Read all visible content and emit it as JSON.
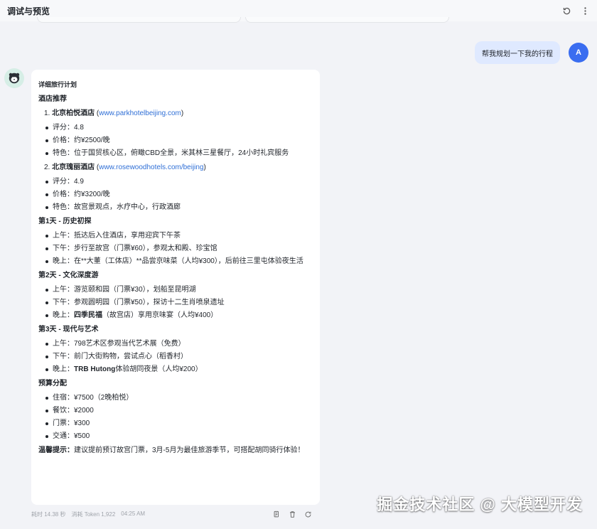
{
  "header": {
    "title": "调试与预览"
  },
  "user_message": {
    "text": "帮我规划一下我的行程",
    "avatar_letter": "A"
  },
  "reply": {
    "heading": "详细旅行计划",
    "hotels_title": "酒店推荐",
    "hotels": [
      {
        "index": "1.",
        "name": "北京柏悦酒店",
        "link": "www.parkhotelbeijing.com",
        "details": [
          "评分：4.8",
          "价格：约¥2500/晚",
          "特色：位于国贸核心区，俯瞰CBD全景，米其林三星餐厅，24小时礼宾服务"
        ]
      },
      {
        "index": "2.",
        "name": "北京瑰丽酒店",
        "link": "www.rosewoodhotels.com/beijing",
        "details": [
          "评分：4.9",
          "价格：约¥3200/晚",
          "特色：故宫景观点，水疗中心，行政酒廊"
        ]
      }
    ],
    "days": [
      {
        "title": "第1天 - 历史初探",
        "items": [
          {
            "prefix": "上午：",
            "bold": "",
            "rest": "抵达后入住酒店，享用迎宾下午茶"
          },
          {
            "prefix": "下午：",
            "bold": "",
            "rest": "步行至故宫（门票¥60），参观太和殿、珍宝馆"
          },
          {
            "prefix": "晚上：",
            "bold": "",
            "rest": "在**大董（工体店）**品尝京味菜（人均¥300），后前往三里屯体验夜生活"
          }
        ]
      },
      {
        "title": "第2天 - 文化深度游",
        "items": [
          {
            "prefix": "上午：",
            "bold": "",
            "rest": "游览颐和园（门票¥30），划船至昆明湖"
          },
          {
            "prefix": "下午：",
            "bold": "",
            "rest": "参观圆明园（门票¥50），探访十二生肖喷泉遗址"
          },
          {
            "prefix": "晚上：",
            "bold": "四季民福",
            "rest": "（故宫店）享用京味宴（人均¥400）"
          }
        ]
      },
      {
        "title": "第3天 - 现代与艺术",
        "items": [
          {
            "prefix": "上午：",
            "bold": "",
            "rest": "798艺术区参观当代艺术展（免费）"
          },
          {
            "prefix": "下午：",
            "bold": "",
            "rest": "前门大街购物，尝试点心（稻香村）"
          },
          {
            "prefix": "晚上：",
            "bold": "TRB Hutong",
            "rest": "体验胡同夜景（人均¥200）"
          }
        ]
      }
    ],
    "budget_title": "预算分配",
    "budget": [
      "住宿：¥7500（2晚柏悦）",
      "餐饮：¥2000",
      "门票：¥300",
      "交通：¥500"
    ],
    "tips_label": "温馨提示：",
    "tips_text": "建议提前预订故宫门票，3月-5月为最佳旅游季节，可搭配胡同骑行体验！"
  },
  "meta": {
    "elapsed": "耗时 14.38 秒",
    "tokens": "消耗 Token 1,922",
    "time": "04:25 AM"
  },
  "watermark": "掘金技术社区 @ 大模型开发",
  "icons": {
    "refresh": "refresh-icon",
    "more": "more-icon",
    "copy": "copy-icon",
    "delete": "trash-icon",
    "regenerate": "regenerate-icon",
    "bot": "bot-avatar-icon"
  },
  "colors": {
    "accent": "#3a6df0",
    "user_bubble": "#dfe9ff",
    "link": "#2f6fd6",
    "background": "#f2f3f7"
  }
}
